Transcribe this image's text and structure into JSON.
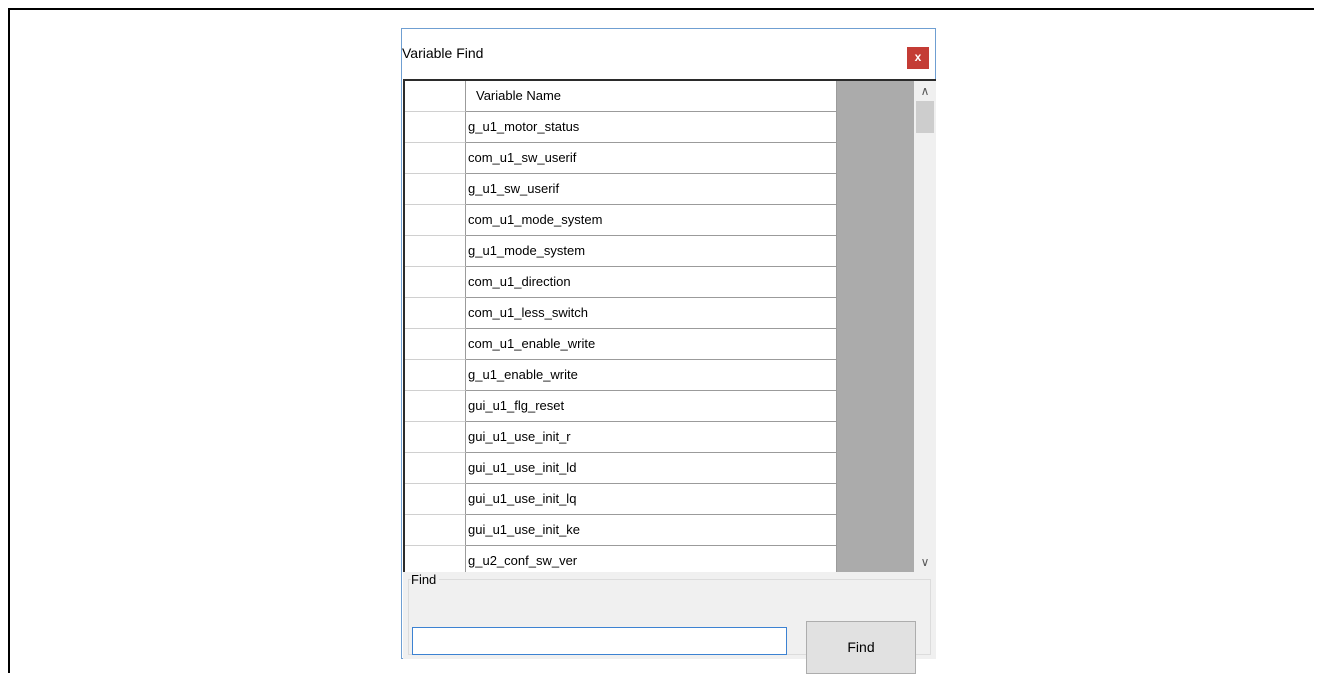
{
  "dialog": {
    "title": "Variable Find",
    "close_label": "x"
  },
  "grid": {
    "column_header": "Variable Name",
    "rows": [
      "g_u1_motor_status",
      "com_u1_sw_userif",
      "g_u1_sw_userif",
      "com_u1_mode_system",
      "g_u1_mode_system",
      "com_u1_direction",
      "com_u1_less_switch",
      "com_u1_enable_write",
      "g_u1_enable_write",
      "gui_u1_flg_reset",
      "gui_u1_use_init_r",
      "gui_u1_use_init_ld",
      "gui_u1_use_init_lq",
      "gui_u1_use_init_ke",
      "g_u2_conf_sw_ver"
    ]
  },
  "find": {
    "group_label": "Find",
    "input_value": "",
    "button_label": "Find"
  }
}
